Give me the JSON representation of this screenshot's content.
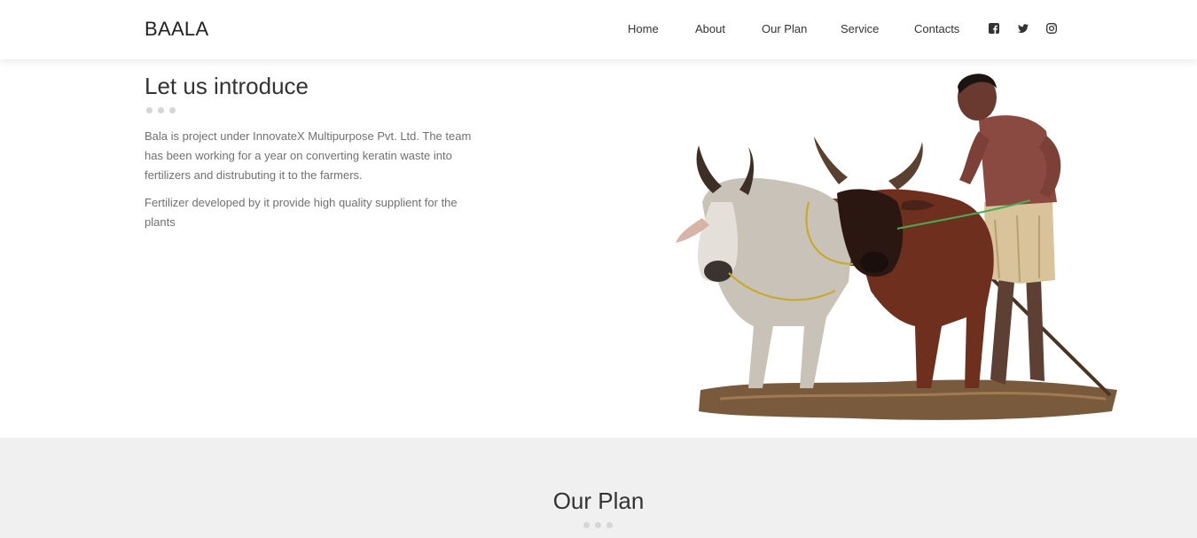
{
  "header": {
    "brand": "BAALA",
    "nav": [
      {
        "label": "Home"
      },
      {
        "label": "About"
      },
      {
        "label": "Our Plan"
      },
      {
        "label": "Service"
      },
      {
        "label": "Contacts"
      }
    ],
    "social": [
      "facebook-icon",
      "twitter-icon",
      "instagram-icon"
    ]
  },
  "intro": {
    "title": "Let us introduce",
    "paragraph1": "Bala is project under InnovateX Multipurpose Pvt. Ltd. The team has been working for a year on converting keratin waste into fertilizers and distrubuting it to the farmers.",
    "paragraph2": "Fertilizer developed by it provide high quality supplient for the plants"
  },
  "plan": {
    "title": "Our Plan"
  },
  "colors": {
    "text": "#333333",
    "muted": "#707070",
    "dots": "#d6d6d6",
    "section_bg": "#f0f0f0"
  }
}
